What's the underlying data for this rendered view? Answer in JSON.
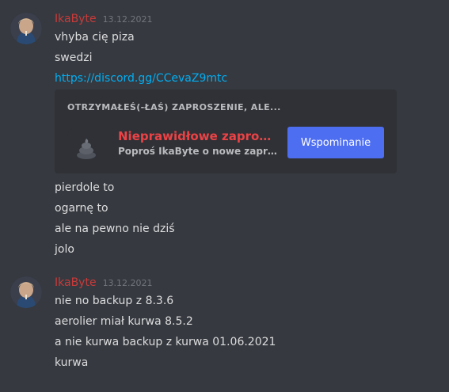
{
  "messages": [
    {
      "username": "IkaByte",
      "timestamp": "13.12.2021",
      "lines_before": [
        "vhyba cię piza",
        "swedzi"
      ],
      "link": "https://discord.gg/CCevaZ9mtc",
      "invite": {
        "title": "OTRZYMAŁEŚ(-ŁAŚ) ZAPROSZENIE, ALE...",
        "name": "Nieprawidłowe zaprosze...",
        "subtitle": "Poproś IkaByte o nowe zaprosze...",
        "button_label": "Wspominanie",
        "icon": "poop-icon"
      },
      "lines_after": [
        "pierdole to",
        "ogarnę to",
        "ale na pewno nie dziś",
        "jolo"
      ]
    },
    {
      "username": "IkaByte",
      "timestamp": "13.12.2021",
      "lines": [
        "nie no backup z 8.3.6",
        "aerolier miał kurwa 8.5.2",
        "a nie kurwa backup z kurwa 01.06.2021",
        "kurwa"
      ]
    }
  ],
  "colors": {
    "background": "#36393f",
    "username": "#c83a3a",
    "link": "#00aff4",
    "invalid_invite": "#ed4245",
    "button": "#4e6ef2"
  }
}
